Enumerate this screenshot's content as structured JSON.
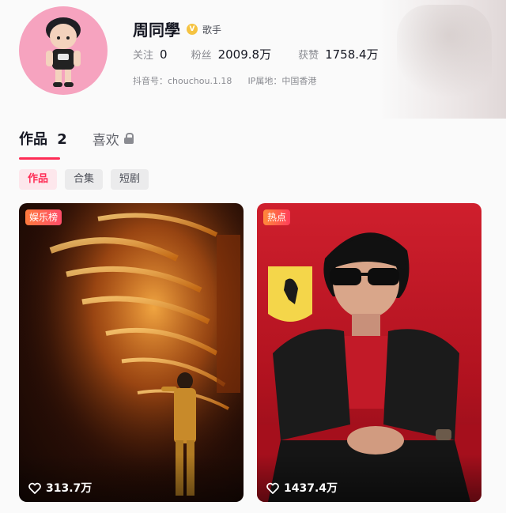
{
  "profile": {
    "name": "周同學",
    "verify_badge": "V",
    "tag": "歌手",
    "stats": {
      "following_label": "关注",
      "following_value": "0",
      "followers_label": "粉丝",
      "followers_value": "2009.8万",
      "likes_label": "获赞",
      "likes_value": "1758.4万"
    },
    "douyin_id": "抖音号：chouchou.1.18",
    "ip_location": "IP属地：中国香港"
  },
  "tabs": {
    "works_label": "作品",
    "works_count": "2",
    "likes_label": "喜欢"
  },
  "filters": [
    "作品",
    "合集",
    "短剧"
  ],
  "videos": [
    {
      "badge": "娱乐榜",
      "likes": "313.7万"
    },
    {
      "badge": "热点",
      "likes": "1437.4万"
    }
  ],
  "colors": {
    "accent": "#fe2c55",
    "avatar_bg": "#f6a3bf"
  },
  "icons": {
    "verified": "verified-badge-icon",
    "lock": "lock-icon",
    "heart": "heart-icon"
  }
}
